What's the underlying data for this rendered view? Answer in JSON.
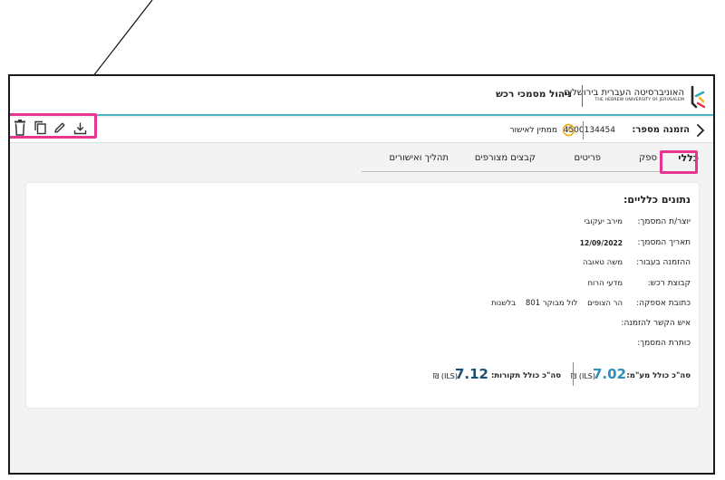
{
  "header": {
    "logo_he": "האוניברסיטה העברית בירושלים",
    "logo_en": "THE HEBREW UNIVERSITY OF JERUSALEM",
    "app_title": "ניהול מסמכי רכש"
  },
  "order": {
    "label": "הזמנה מספר:",
    "number": "4500134454",
    "status": "ממתין לאישור"
  },
  "toolbar": {
    "icons": [
      "trash-icon",
      "copy-icon",
      "pencil-icon",
      "download-icon"
    ]
  },
  "tabs": [
    {
      "label": "כללי",
      "active": true
    },
    {
      "label": "ספק",
      "active": false
    },
    {
      "label": "פריטים",
      "active": false
    },
    {
      "label": "קבצים מצורפים",
      "active": false
    },
    {
      "label": "תהליך ואישורים",
      "active": false
    }
  ],
  "general": {
    "title": "נתונים כלליים:",
    "fields": [
      {
        "label": "יוצר/ת המסמך:",
        "value": "מירב יעקובי"
      },
      {
        "label": "תאריך המסמך:",
        "value": "12/09/2022"
      },
      {
        "label": "ההזמנה בעבור:",
        "value": "משה טאובה"
      },
      {
        "label": "קבוצת רכש:",
        "value": "מדעי הרוח"
      },
      {
        "label": "כתובת אספקה:",
        "value": "הר הצופים    לול מבוקר 801    בלשנות"
      },
      {
        "label": "איש הקשר להזמנה:",
        "value": ""
      },
      {
        "label": "כותרת המסמך:",
        "value": ""
      }
    ]
  },
  "totals": {
    "vat_label": "סה\"כ כולל מע\"מ:",
    "vat_value": "7.02",
    "vat_currency": "₪ (ILS)",
    "budget_label": "סה\"כ כולל תקורות:",
    "budget_value": "7.12",
    "budget_currency": "₪ (ILS)"
  },
  "colors": {
    "accent_teal": "#4db6c2",
    "highlight_pink": "#e8368f",
    "vat_value_color": "#2f8fb8",
    "budget_value_color": "#1d4f73",
    "status_icon": "#f0a500"
  }
}
